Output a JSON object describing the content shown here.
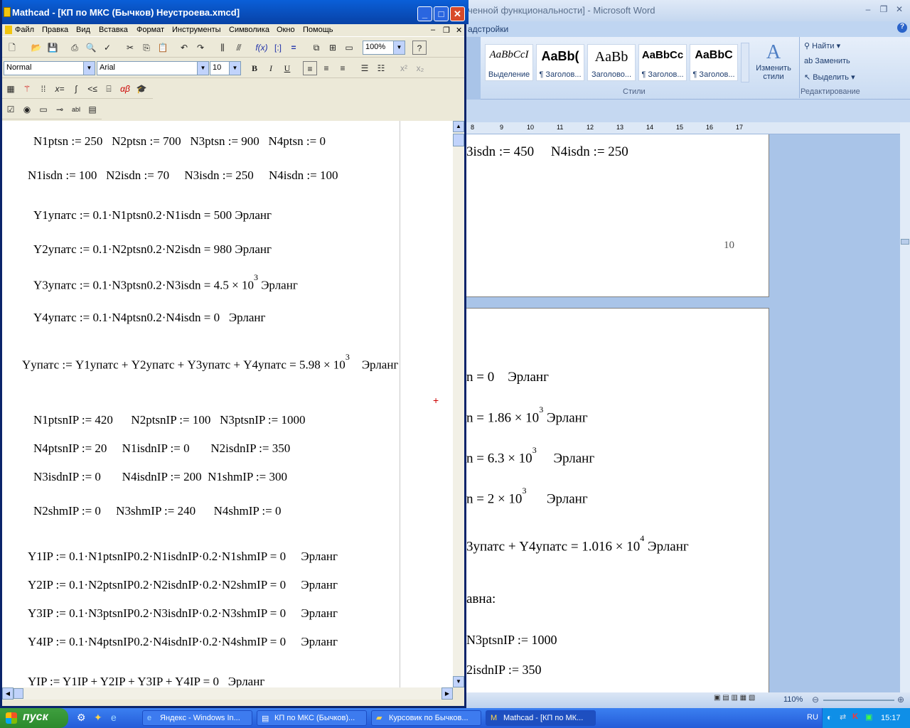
{
  "word": {
    "title": "ченной функциональности] - Microsoft Word",
    "tab_partial": "адстройки",
    "ribbon": {
      "styles": [
        {
          "sample": "AaBbCcI",
          "name": "Выделение"
        },
        {
          "sample": "AaBb(",
          "name": "¶ Заголов..."
        },
        {
          "sample": "AaBb",
          "name": "Заголово..."
        },
        {
          "sample": "AaBbCc",
          "name": "¶ Заголов..."
        },
        {
          "sample": "AaBbC",
          "name": "¶ Заголов..."
        }
      ],
      "change_styles": "Изменить стили",
      "styles_group": "Стили",
      "find": "Найти",
      "replace": "Заменить",
      "select": "Выделить",
      "edit_group": "Редактирование"
    },
    "ruler": [
      "8",
      "9",
      "10",
      "11",
      "12",
      "13",
      "14",
      "15",
      "16",
      "17"
    ],
    "page1": {
      "line": "3isdn := 450     N4isdn := 250",
      "page_number": "10"
    },
    "page2": {
      "l1": "n = 0    Эрланг",
      "l2a": "n = 1.86 × 10",
      "l2e": "3",
      "l2b": " Эрланг",
      "l3a": "n = 6.3 × 10",
      "l3e": "3",
      "l3b": "     Эрланг",
      "l4a": "n = 2 × 10",
      "l4e": "3",
      "l4b": "      Эрланг",
      "l5a": "3упатс + Y4упатс = 1.016 × 10",
      "l5e": "4",
      "l5b": " Эрланг",
      "l6": "авна:",
      "l7": "N3ptsnIP := 1000",
      "l8": "2isdnIP := 350"
    },
    "zoom": "110%"
  },
  "mathcad": {
    "title": "Mathcad - [КП по МКС (Бычков) Неустроева.xmcd]",
    "menu": [
      "Файл",
      "Правка",
      "Вид",
      "Вставка",
      "Формат",
      "Инструменты",
      "Символика",
      "Окно",
      "Помощь"
    ],
    "zoom": "100%",
    "style": "Normal",
    "font": "Arial",
    "size": "10",
    "lines": {
      "l1": "N1ptsn := 250   N2ptsn := 700   N3ptsn := 900   N4ptsn := 0",
      "l2": "N1isdn := 100   N2isdn := 70     N3isdn := 250     N4isdn := 100",
      "l3": "Y1упатс := 0.1·N1ptsn0.2·N1isdn = 500 Эрланг",
      "l4": "Y2упатс := 0.1·N2ptsn0.2·N2isdn = 980 Эрланг",
      "l5a": "Y3упатс := 0.1·N3ptsn0.2·N3isdn = 4.5 × 10",
      "l5e": "3",
      "l5b": " Эрланг",
      "l6": "Y4упатс := 0.1·N4ptsn0.2·N4isdn = 0   Эрланг",
      "l7a": "Yупатс := Y1упатс + Y2упатс + Y3упатс + Y4упатс = 5.98 × 10",
      "l7e": "3",
      "l7b": "    Эрланг",
      "l8": "N1ptsnIP := 420      N2ptsnIP := 100   N3ptsnIP := 1000",
      "l9": "N4ptsnIP := 20     N1isdnIP := 0       N2isdnIP := 350",
      "l10": "N3isdnIP := 0       N4isdnIP := 200  N1shmIP := 300",
      "l11": "N2shmIP := 0     N3shmIP := 240      N4shmIP := 0",
      "l12": "Y1IP := 0.1·N1ptsnIP0.2·N1isdnIP·0.2·N1shmIP = 0     Эрланг",
      "l13": "Y2IP := 0.1·N2ptsnIP0.2·N2isdnIP·0.2·N2shmIP = 0     Эрланг",
      "l14": "Y3IP := 0.1·N3ptsnIP0.2·N3isdnIP·0.2·N3shmIP = 0     Эрланг",
      "l15": "Y4IP := 0.1·N4ptsnIP0.2·N4isdnIP·0.2·N4shmIP = 0     Эрланг",
      "l16": "YIP := Y1IP + Y2IP + Y3IP + Y4IP = 0   Эрланг"
    }
  },
  "taskbar": {
    "start": "пуск",
    "tasks": [
      "Яндекс - Windows In...",
      "КП по МКС (Бычков)...",
      "Курсовик по Бычков...",
      "Mathcad - [КП по МК..."
    ],
    "lang": "RU",
    "time": "15:17"
  }
}
